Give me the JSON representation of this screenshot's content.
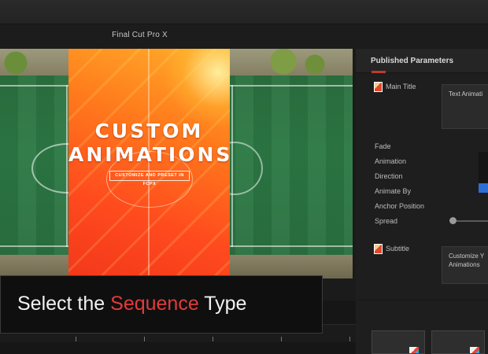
{
  "app": {
    "title": "Final Cut Pro X"
  },
  "viewer": {
    "poster_line1": "CUSTOM",
    "poster_line2": "ANIMATIONS",
    "poster_tagline": "CUSTOMIZE AND PRESET IN FCPX"
  },
  "inspector": {
    "title": "Published Parameters",
    "main_title_label": "Main Title",
    "main_title_value": "Text Animati",
    "params": [
      "Fade",
      "Animation",
      "Direction",
      "Animate By",
      "Anchor Position",
      "Spread"
    ],
    "subtitle_label": "Subtitle",
    "subtitle_value_line1": "Customize Y",
    "subtitle_value_line2": "Animations"
  },
  "caption": {
    "before": "Select the ",
    "highlight": "Sequence",
    "after": " Type"
  },
  "colors": {
    "accent": "#e23b3b",
    "poster_orange": "#ff6a1e",
    "selection_blue": "#2d6fd6"
  }
}
